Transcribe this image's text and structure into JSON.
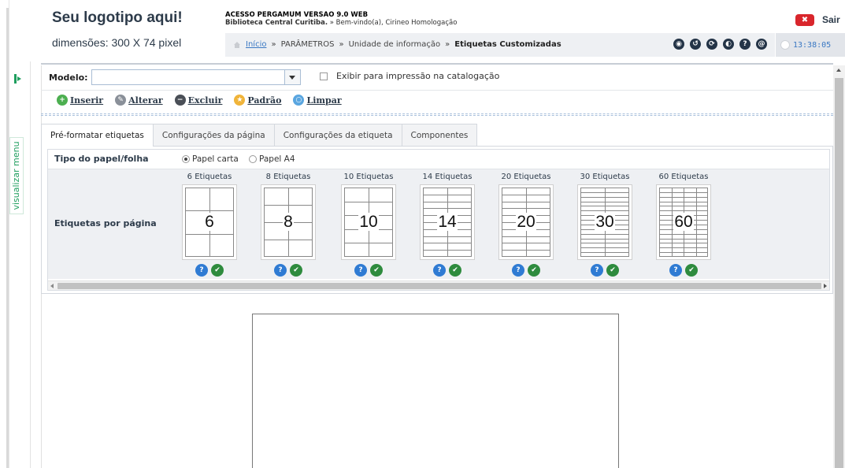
{
  "header": {
    "logo_title": "Seu logotipo aqui!",
    "logo_dims": "dimensões: 300 X 74 pixel",
    "system_title": "ACESSO PERGAMUM VERSAO 9.0 WEB",
    "library_name": "Biblioteca Central Curitiba.",
    "welcome": " » Bem-vindo(a), Cirineo Homologação",
    "sair_label": "Sair",
    "clock_time": "13:38:05",
    "header_icons": [
      "◉",
      "↺",
      "⟳",
      "◐",
      "?",
      "@"
    ]
  },
  "breadcrumb": {
    "home": "Início",
    "sep": "»",
    "items": [
      "PARÂMETROS",
      "Unidade de informação"
    ],
    "current": "Etiquetas Customizadas"
  },
  "side_menu": {
    "label": "visualizar menu"
  },
  "form": {
    "modelo_label": "Modelo:",
    "modelo_value": "",
    "exibir_label": "Exibir para impressão na catalogação"
  },
  "toolbar": {
    "inserir": "Inserir",
    "alterar": "Alterar",
    "excluir": "Excluir",
    "padrao": "Padrão",
    "limpar": "Limpar"
  },
  "tabs": [
    "Pré-formatar etiquetas",
    "Configurações da página",
    "Configurações da etiqueta",
    "Componentes"
  ],
  "paper": {
    "label": "Tipo do papel/folha",
    "options": [
      "Papel carta",
      "Papel A4"
    ],
    "selected": "Papel carta"
  },
  "labels_per_page": {
    "label": "Etiquetas por página",
    "items": [
      {
        "caption": "6 Etiquetas",
        "number": "6"
      },
      {
        "caption": "8 Etiquetas",
        "number": "8"
      },
      {
        "caption": "10 Etiquetas",
        "number": "10"
      },
      {
        "caption": "14 Etiquetas",
        "number": "14"
      },
      {
        "caption": "20 Etiquetas",
        "number": "20"
      },
      {
        "caption": "30 Etiquetas",
        "number": "30"
      },
      {
        "caption": "60 Etiquetas",
        "number": "60"
      }
    ],
    "help_glyph": "?",
    "check_glyph": "✔"
  },
  "colors": {
    "accent_green": "#1e9e5e",
    "navy_text": "#2d3b4a",
    "link_blue": "#3a78c3",
    "sair_red": "#d9262c",
    "help_blue": "#2f7bd3",
    "check_green": "#2e8b3e"
  }
}
